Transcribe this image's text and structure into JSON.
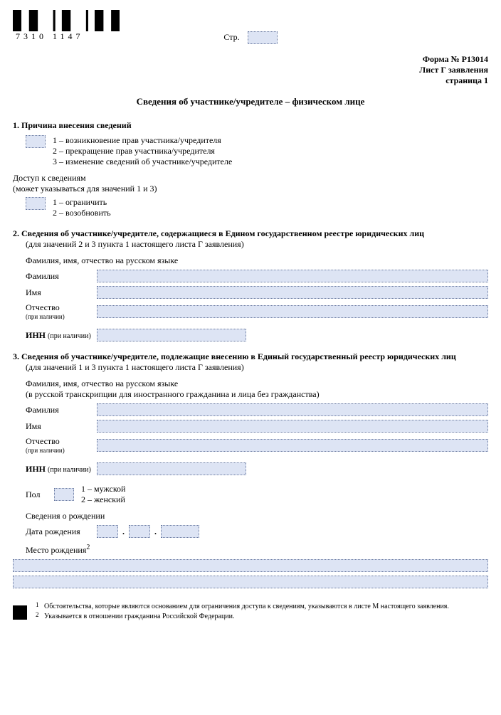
{
  "header": {
    "barcode_number": "7310 1147",
    "page_label": "Стр.",
    "form_no": "Форма № Р13014",
    "sheet": "Лист Г заявления",
    "page": "страница 1"
  },
  "title": "Сведения об участнике/учредителе – физическом лице",
  "sec1": {
    "head": "1. Причина внесения сведений",
    "opt1": "1 – возникновение прав участника/учредителя",
    "opt2": "2 – прекращение прав участника/учредителя",
    "opt3": "3 – изменение сведений об участнике/учредителе",
    "access_head": "Доступ к сведениям",
    "access_note": "(может указываться для значений 1 и 3)",
    "lim1": "1 – ограничить",
    "lim2": "2 – возобновить"
  },
  "sec2": {
    "head": "2. Сведения об участнике/учредителе, содержащиеся в Едином государственном реестре юридических лиц",
    "sub": "(для значений 2 и 3 пункта 1 настоящего листа Г заявления)",
    "fio_label": "Фамилия, имя, отчество на русском языке",
    "fam": "Фамилия",
    "name": "Имя",
    "patr": "Отчество",
    "patr_note": "(при наличии)",
    "inn": "ИНН",
    "inn_note": "(при наличии)"
  },
  "sec3": {
    "head": "3. Сведения об участнике/учредителе, подлежащие внесению в Единый государственный реестр юридических лиц",
    "sub": "(для значений 1 и 3 пункта 1 настоящего листа Г заявления)",
    "fio_label": "Фамилия, имя, отчество на русском языке",
    "fio_sub": "(в русской транскрипции для иностранного гражданина и лица без гражданства)",
    "fam": "Фамилия",
    "name": "Имя",
    "patr": "Отчество",
    "patr_note": "(при наличии)",
    "inn": "ИНН",
    "inn_note": "(при наличии)",
    "sex": "Пол",
    "sex1": "1 – мужской",
    "sex2": "2 – женский",
    "birth_head": "Сведения о рождении",
    "dob": "Дата рождения",
    "pob": "Место рождения",
    "pob_sup": "2"
  },
  "footnotes": {
    "n1": "Обстоятельства, которые являются основанием для ограничения доступа к сведениям, указываются в листе М настоящего заявления.",
    "n2": "Указывается в отношении гражданина Российской Федерации."
  }
}
